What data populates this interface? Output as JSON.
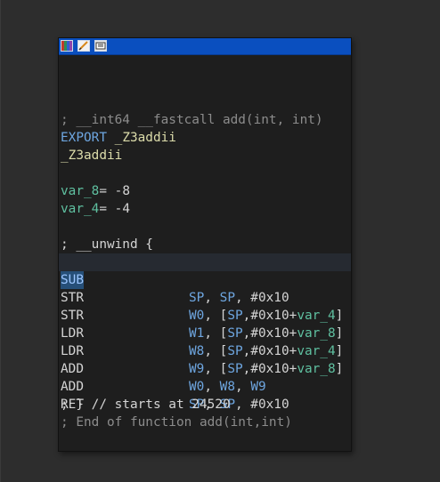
{
  "titlebar": {
    "icons": [
      "graph-view-icon",
      "edit-icon",
      "hex-view-icon"
    ]
  },
  "code": {
    "header_comment": "; __int64 __fastcall add(int, int)",
    "export_kw": "EXPORT",
    "export_sym": "_Z3addii",
    "label": "_Z3addii",
    "var8_name": "var_8",
    "var8_val": "= -8",
    "var4_name": "var_4",
    "var4_val": "= -4",
    "unwind": "; __unwind {",
    "instructions": [
      {
        "mnemonic": "SUB",
        "ops": [
          "SP",
          ", ",
          "SP",
          ", #0x10"
        ]
      },
      {
        "mnemonic": "STR",
        "ops": [
          "W0",
          ", [",
          "SP",
          ",#0x10+",
          "var_4",
          "]"
        ]
      },
      {
        "mnemonic": "STR",
        "ops": [
          "W1",
          ", [",
          "SP",
          ",#0x10+",
          "var_8",
          "]"
        ]
      },
      {
        "mnemonic": "LDR",
        "ops": [
          "W8",
          ", [",
          "SP",
          ",#0x10+",
          "var_4",
          "]"
        ]
      },
      {
        "mnemonic": "LDR",
        "ops": [
          "W9",
          ", [",
          "SP",
          ",#0x10+",
          "var_8",
          "]"
        ]
      },
      {
        "mnemonic": "ADD",
        "ops": [
          "W0",
          ", ",
          "W8",
          ", ",
          "W9"
        ]
      },
      {
        "mnemonic": "ADD",
        "ops": [
          "SP",
          ", ",
          "SP",
          ", #0x10"
        ]
      },
      {
        "mnemonic": "RET",
        "ops": []
      }
    ],
    "closing": "; } // starts at 24520",
    "end_comment": "; End of function add(int,int)"
  },
  "colors": {
    "background": "#2d2d2d",
    "window_bg": "#1e1e1e",
    "titlebar": "#0a4fbf",
    "comment": "#8c8c8c",
    "register": "#6ea6e0",
    "variable": "#5fc0a0",
    "symbol": "#dcdcaa"
  }
}
